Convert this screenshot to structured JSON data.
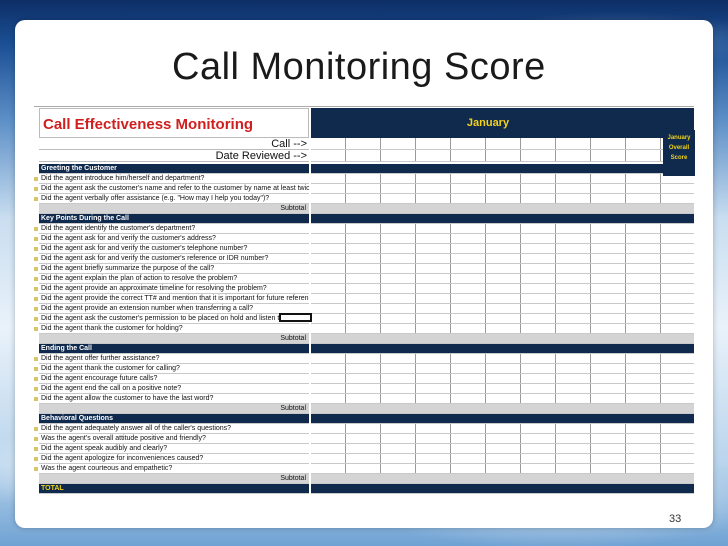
{
  "slide": {
    "title": "Call Monitoring Score",
    "page_number": "33"
  },
  "sheet": {
    "title": "Call Effectiveness Monitoring",
    "month": "January",
    "overall_label": [
      "January",
      "Overall",
      "Score"
    ],
    "meta_rows": [
      "Call -->",
      "Date Reviewed -->"
    ],
    "sections": [
      {
        "header": "Greeting the Customer",
        "items": [
          "Did the agent introduce him/herself and department?",
          "Did the agent ask the customer's name and refer to the customer by name at least twice?",
          "Did the agent verbally offer assistance (e.g. \"How may I help you today\")?"
        ],
        "subtotal": "Subtotal"
      },
      {
        "header": "Key Points During the Call",
        "items": [
          "Did the agent identify the customer's department?",
          "Did the agent ask for and verify the customer's address?",
          "Did the agent ask for and verify the customer's telephone number?",
          "Did the agent ask for and verify the customer's reference or IDR number?",
          "Did the agent briefly summarize the purpose of the call?",
          "Did the agent explain the plan of action to resolve the problem?",
          "Did the agent provide an approximate timeline for resolving the problem?",
          "Did the agent provide the correct TT# and mention that it is important for future reference?",
          "Did the agent provide an extension number when transferring a call?",
          "Did the agent ask the customer's permission to be placed on hold and listen to the response?",
          "Did the agent thank the customer for holding?"
        ],
        "subtotal": "Subtotal"
      },
      {
        "header": "Ending the Call",
        "items": [
          "Did the agent offer further assistance?",
          "Did the agent thank the customer for calling?",
          "Did the agent encourage future calls?",
          "Did the agent end the call on a positive note?",
          "Did the agent allow the customer to have the last word?"
        ],
        "subtotal": "Subtotal"
      },
      {
        "header": "Behavioral Questions",
        "items": [
          "Did the agent adequately answer all of the caller's questions?",
          "Was the agent's overall attitude positive and friendly?",
          "Did the agent speak audibly and clearly?",
          "Did the agent apologize for inconveniences caused?",
          "Was the agent courteous and empathetic?"
        ],
        "subtotal": "Subtotal"
      }
    ],
    "total_label": "TOTAL",
    "colors": {
      "header_navy": "#0f2a4d",
      "title_red": "#d01f1f",
      "accent_yellow": "#f2d21b",
      "subtotal_gray": "#d4d4d4"
    }
  }
}
